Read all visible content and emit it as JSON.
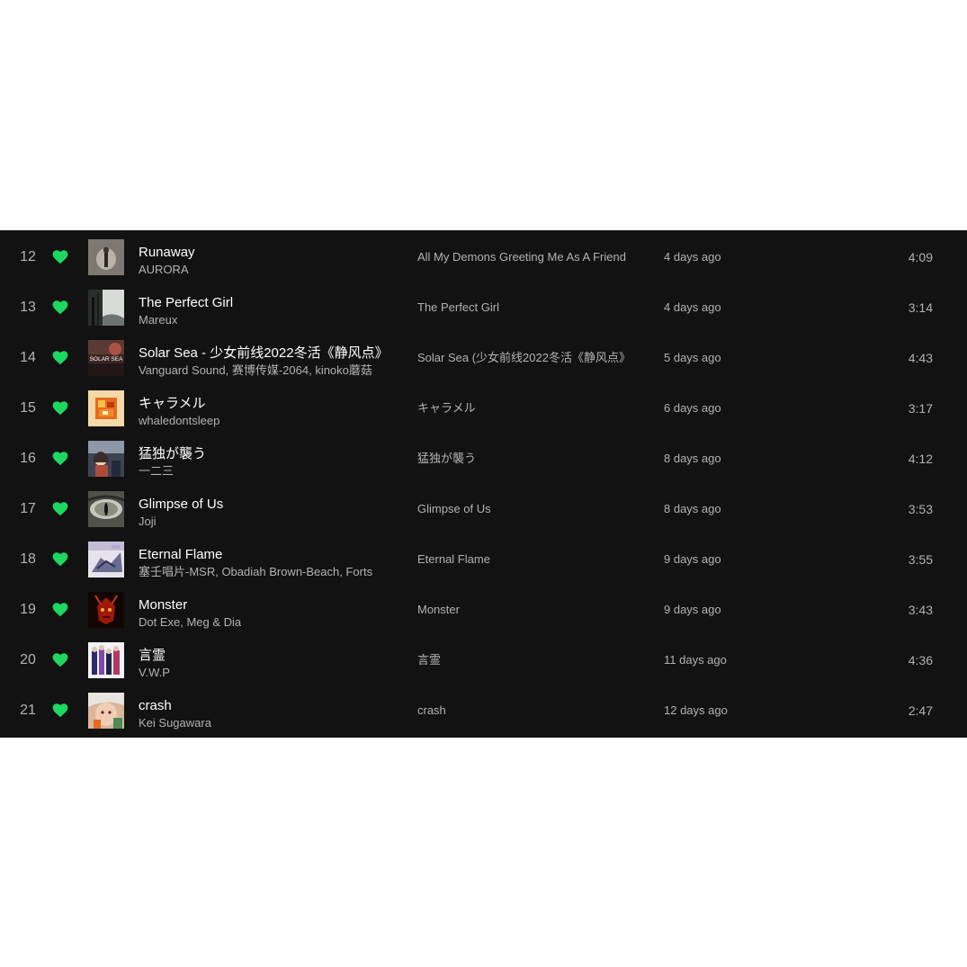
{
  "colors": {
    "background": "#121212",
    "accent_green": "#1ed760",
    "primary_text": "#ffffff",
    "secondary_text": "#b3b3b3"
  },
  "tracks": [
    {
      "number": "12",
      "title": "Runaway",
      "artist": "AURORA",
      "album": "All My Demons Greeting Me As A Friend",
      "added": "4 days ago",
      "duration": "4:09",
      "liked": true,
      "cover_icon": "angel-figure-cover"
    },
    {
      "number": "13",
      "title": "The Perfect Girl",
      "artist": "Mareux",
      "album": "The Perfect Girl",
      "added": "4 days ago",
      "duration": "3:14",
      "liked": true,
      "cover_icon": "dark-forest-cover"
    },
    {
      "number": "14",
      "title": "Solar Sea - 少女前线2022冬活《静风点》",
      "artist": "Vanguard Sound, 赛博传媒-2064, kinoko蘑菇",
      "album": "Solar Sea (少女前线2022冬活《静风点》",
      "added": "5 days ago",
      "duration": "4:43",
      "liked": true,
      "cover_icon": "solar-sea-cover"
    },
    {
      "number": "15",
      "title": "キャラメル",
      "artist": "whaledontsleep",
      "album": "キャラメル",
      "added": "6 days ago",
      "duration": "3:17",
      "liked": true,
      "cover_icon": "orange-collage-cover"
    },
    {
      "number": "16",
      "title": "猛独が襲う",
      "artist": "一二三",
      "album": "猛独が襲う",
      "added": "8 days ago",
      "duration": "4:12",
      "liked": true,
      "cover_icon": "anime-girl-cover"
    },
    {
      "number": "17",
      "title": "Glimpse of Us",
      "artist": "Joji",
      "album": "Glimpse of Us",
      "added": "8 days ago",
      "duration": "3:53",
      "liked": true,
      "cover_icon": "reptile-eye-cover"
    },
    {
      "number": "18",
      "title": "Eternal Flame",
      "artist": "塞壬唱片-MSR, Obadiah Brown-Beach, Forts",
      "album": "Eternal Flame",
      "added": "9 days ago",
      "duration": "3:55",
      "liked": true,
      "cover_icon": "mecha-illustration-cover"
    },
    {
      "number": "19",
      "title": "Monster",
      "artist": "Dot Exe, Meg & Dia",
      "album": "Monster",
      "added": "9 days ago",
      "duration": "3:43",
      "liked": true,
      "cover_icon": "red-demon-cover"
    },
    {
      "number": "20",
      "title": "言霊",
      "artist": "V.W.P",
      "album": "言霊",
      "added": "11 days ago",
      "duration": "4:36",
      "liked": true,
      "cover_icon": "anime-group-cover"
    },
    {
      "number": "21",
      "title": "crash",
      "artist": "Kei Sugawara",
      "album": "crash",
      "added": "12 days ago",
      "duration": "2:47",
      "liked": true,
      "cover_icon": "illustrated-face-cover"
    }
  ]
}
